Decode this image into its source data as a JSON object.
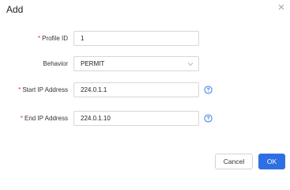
{
  "dialog": {
    "title": "Add",
    "close_icon": "close-icon"
  },
  "form": {
    "profile_id": {
      "label": "Profile ID",
      "required": true,
      "value": "1"
    },
    "behavior": {
      "label": "Behavior",
      "required": false,
      "value": "PERMIT",
      "icon": "chevron-down-icon"
    },
    "start_ip": {
      "label": "Start IP Address",
      "required": true,
      "value": "224.0.1.1",
      "help_icon": "help-circle-icon"
    },
    "end_ip": {
      "label": "End IP Address",
      "required": true,
      "value": "224.0.1.10",
      "help_icon": "help-circle-icon"
    },
    "required_marker": "*"
  },
  "footer": {
    "cancel_label": "Cancel",
    "ok_label": "OK"
  },
  "colors": {
    "primary": "#2f6fe4",
    "required": "#e8342b",
    "border": "#d4d7dd"
  }
}
